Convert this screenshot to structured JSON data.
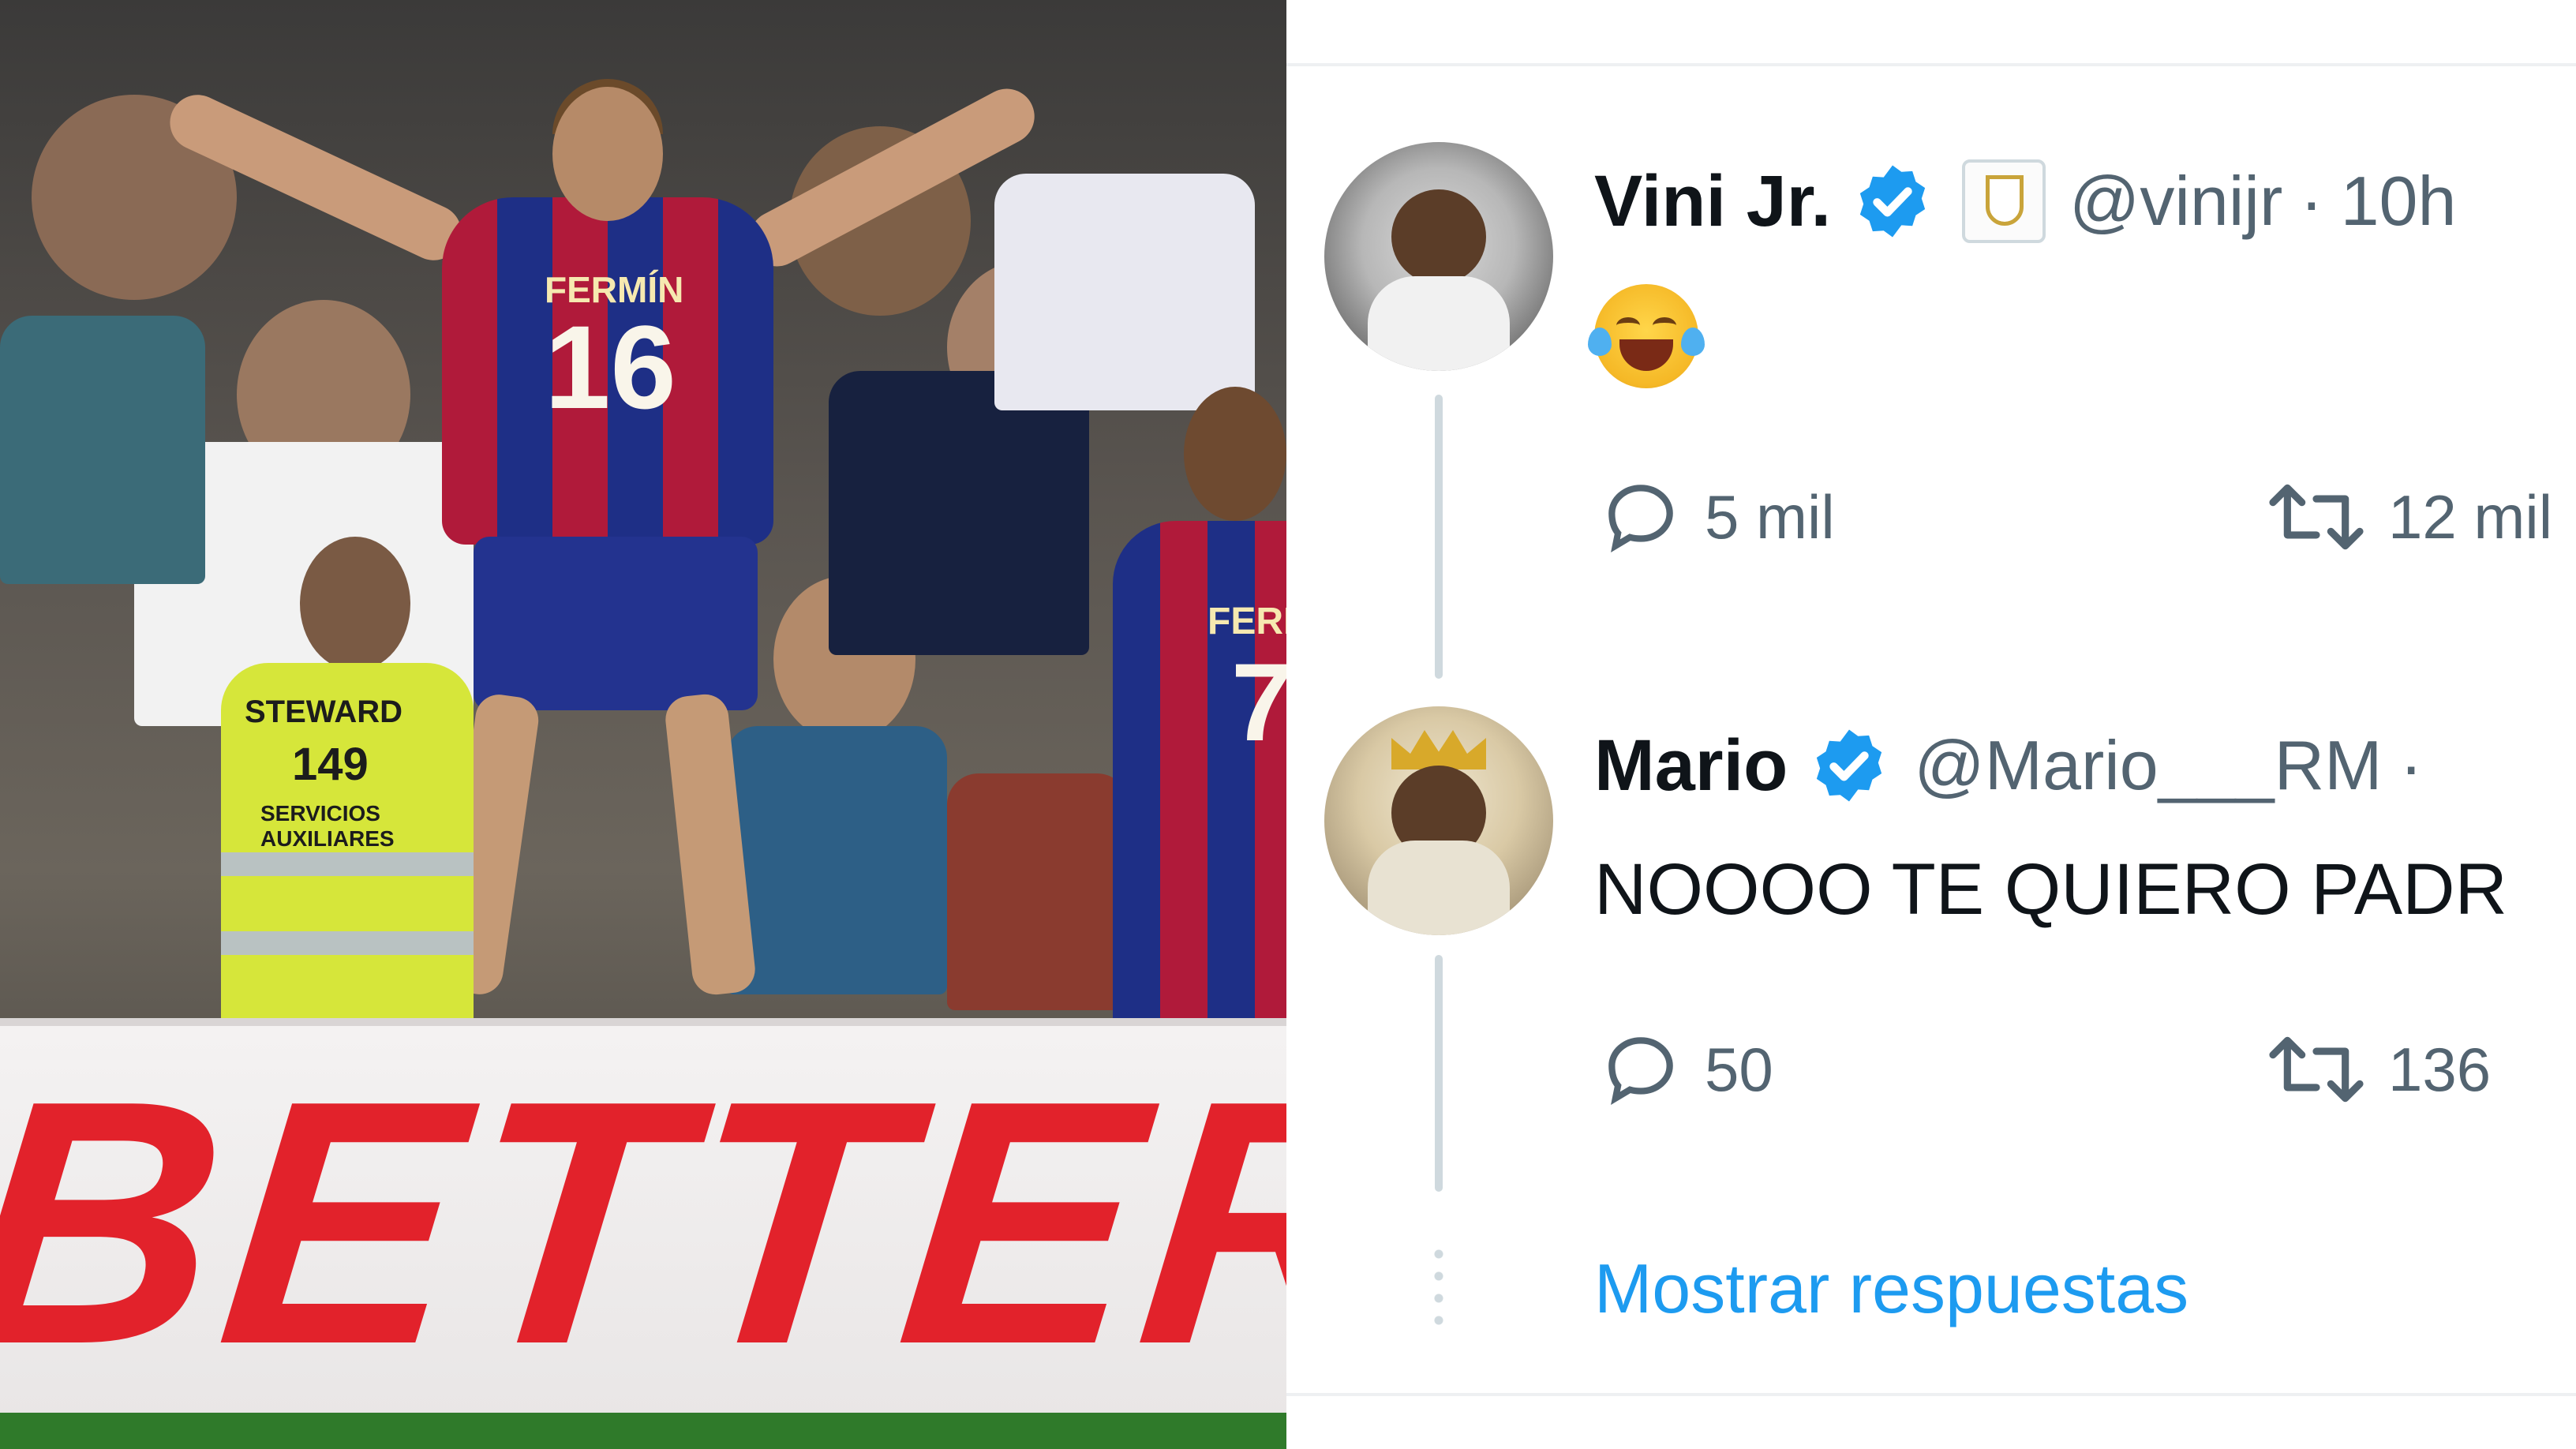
{
  "photo": {
    "board_text": "BETTER",
    "player_name": "FERMÍN",
    "player_number": "16",
    "steward_label": "STEWARD",
    "steward_number": "149",
    "steward_sub": "SERVICIOS AUXILIARES",
    "second_player_name": "FERR",
    "second_player_number": "7"
  },
  "tweets": [
    {
      "display_name": "Vini Jr.",
      "verified": true,
      "affiliate_badge": "real-madrid-crest-icon",
      "handle": "@vinijr",
      "separator": "·",
      "time": "10h",
      "body_emoji": "face-with-tears-of-joy-icon",
      "replies": "5 mil",
      "retweets": "12 mil"
    },
    {
      "display_name": "Mario",
      "verified": true,
      "handle": "@Mario___RM",
      "separator": "·",
      "body": "NOOOO TE QUIERO PADR",
      "replies": "50",
      "retweets": "136"
    }
  ],
  "show_replies_label": "Mostrar respuestas",
  "colors": {
    "verified_blue": "#1d9bf0",
    "link_blue": "#1d9bf0",
    "secondary_text": "#536471",
    "primary_text": "#0f1419",
    "thread_line": "#cfd9de"
  }
}
